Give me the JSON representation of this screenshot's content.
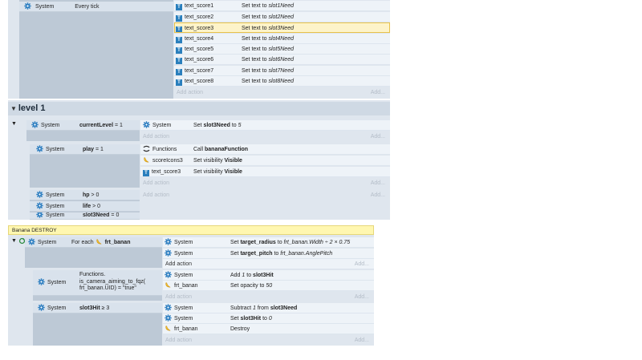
{
  "top_event": {
    "condition": {
      "object": "System",
      "text": "Every tick"
    },
    "actions": [
      {
        "object": "text_score1",
        "prefix": "Set text to ",
        "value": "slot1Need"
      },
      {
        "object": "text_score2",
        "prefix": "Set text to ",
        "value": "slot2Need"
      },
      {
        "object": "text_score3",
        "prefix": "Set text to ",
        "value": "slot3Need"
      },
      {
        "object": "text_score4",
        "prefix": "Set text to ",
        "value": "slot4Need"
      },
      {
        "object": "text_score5",
        "prefix": "Set text to ",
        "value": "slot5Need"
      },
      {
        "object": "text_score6",
        "prefix": "Set text to ",
        "value": "slot6Need"
      },
      {
        "object": "text_score7",
        "prefix": "Set text to ",
        "value": "slot7Need"
      },
      {
        "object": "text_score8",
        "prefix": "Set text to ",
        "value": "slot8Need"
      }
    ],
    "add_action": "Add action",
    "add": "Add..."
  },
  "group": {
    "title": "level 1",
    "event1": {
      "condition": {
        "object": "System",
        "var": "currentLevel",
        "op": " = 1"
      },
      "action": {
        "object": "System",
        "prefix": "Set ",
        "var": "slot3Need",
        "mid": " to ",
        "value": "5"
      },
      "add_action": "Add action",
      "add": "Add..."
    },
    "event2": {
      "condition": {
        "object": "System",
        "var": "play",
        "op": " = 1"
      },
      "actions": [
        {
          "object": "Functions",
          "prefix": "Call ",
          "value": "bananaFunction"
        },
        {
          "object": "scoreIcons3",
          "prefix": "Set visibility ",
          "value": "Visible"
        },
        {
          "object": "text_score3",
          "prefix": "Set visibility ",
          "value": "Visible"
        }
      ],
      "add_action": "Add action",
      "add": "Add..."
    },
    "event3": {
      "conditions": [
        {
          "object": "System",
          "var": "hp",
          "op": " > 0"
        },
        {
          "object": "System",
          "var": "life",
          "op": " > 0"
        },
        {
          "object": "System",
          "var": "slot3Need",
          "op": " = 0"
        }
      ],
      "add_action": "Add action",
      "add": "Add..."
    }
  },
  "banana": {
    "comment": "Banana DESTROY",
    "event1": {
      "condition": {
        "object": "System",
        "prefix": "For each ",
        "target": "frt_banan"
      },
      "actions": [
        {
          "object": "System",
          "prefix": "Set ",
          "var": "target_radius",
          "mid": " to ",
          "value": "frt_banan.Width ÷ 2 × 0.75"
        },
        {
          "object": "System",
          "prefix": "Set ",
          "var": "target_pitch",
          "mid": " to ",
          "value": "frt_banan.AnglePitch"
        }
      ],
      "add_action": "Add action",
      "add": "Add..."
    },
    "event2": {
      "condition": {
        "object": "System",
        "line1": "Functions.",
        "line2": "is_camera_aiming_to_fqz(",
        "line3": "frt_banan.UID) = \"true\""
      },
      "actions": [
        {
          "object": "System",
          "prefix": "Add ",
          "value": "1",
          "mid": " to ",
          "var": "slot3Hit"
        },
        {
          "object": "frt_banan",
          "prefix": "Set opacity to ",
          "value": "50"
        }
      ],
      "add_action": "Add action",
      "add": "Add..."
    },
    "event3": {
      "condition": {
        "object": "System",
        "var": "slot3Hit",
        "op": " ≥ 3"
      },
      "actions": [
        {
          "object": "System",
          "prefix": "Subtract ",
          "value": "1",
          "mid": " from ",
          "var": "slot3Need"
        },
        {
          "object": "System",
          "prefix": "Set ",
          "var": "slot3Hit",
          "mid": " to ",
          "value": "0"
        },
        {
          "object": "frt_banan",
          "prefix": "",
          "value": "Destroy"
        }
      ],
      "add_action": "Add action",
      "add": "Add..."
    }
  },
  "icons": {
    "system": "gear-icon",
    "text": "text-object-icon",
    "sprite": "banana-sprite-icon",
    "functions": "functions-icon",
    "expand": "collapse-arrow-icon",
    "loop": "loop-icon"
  }
}
